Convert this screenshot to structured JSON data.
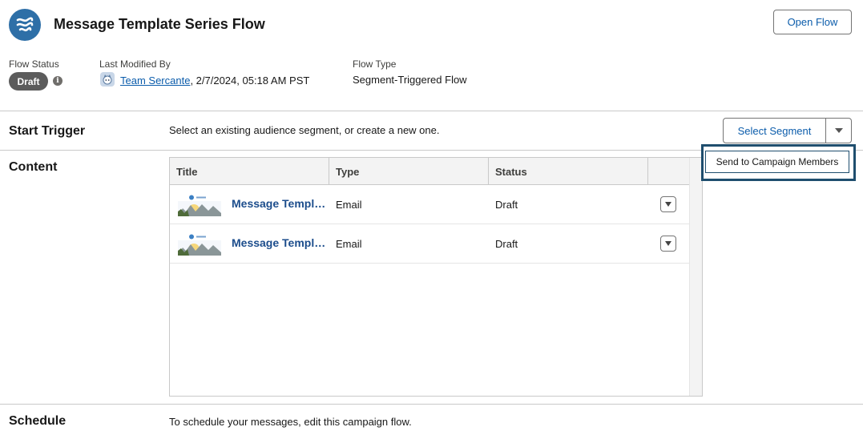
{
  "header": {
    "title": "Message Template Series Flow",
    "open_flow_label": "Open Flow",
    "app_icon": "flow-waves-icon"
  },
  "meta": {
    "flow_status_label": "Flow Status",
    "flow_status_value": "Draft",
    "last_modified_label": "Last Modified By",
    "last_modified_user": "Team Sercante",
    "last_modified_date": ", 2/7/2024, 05:18 AM PST",
    "flow_type_label": "Flow Type",
    "flow_type_value": "Segment-Triggered Flow"
  },
  "start_trigger": {
    "title": "Start Trigger",
    "description": "Select an existing audience segment, or create a new one.",
    "select_segment_label": "Select Segment",
    "menu_item": "Send to Campaign Members"
  },
  "content": {
    "title": "Content",
    "columns": [
      "Title",
      "Type",
      "Status"
    ],
    "rows": [
      {
        "title": "Message Template",
        "type": "Email",
        "status": "Draft"
      },
      {
        "title": "Message Template",
        "type": "Email",
        "status": "Draft"
      }
    ]
  },
  "schedule": {
    "title": "Schedule",
    "description": "To schedule your messages, edit this campaign flow."
  },
  "colors": {
    "brand": "#2e6fa7",
    "link": "#0b5cab",
    "badge": "#5c5c5c",
    "focus": "#1f4e6e"
  }
}
